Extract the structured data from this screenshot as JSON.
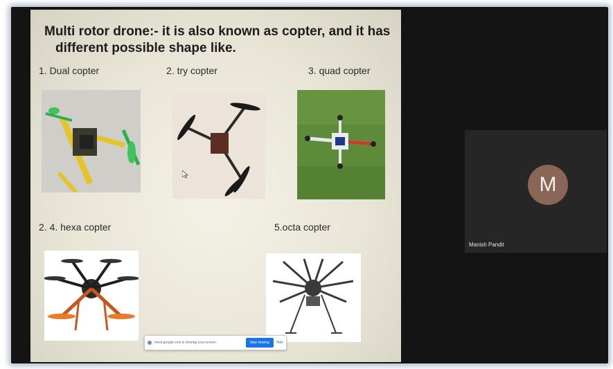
{
  "slide": {
    "title_line1": "Multi rotor  drone:- it is also known as copter, and it has",
    "title_line2": "different  possible shape like.",
    "items": [
      {
        "label": "1.   Dual copter"
      },
      {
        "label": "2.  try copter"
      },
      {
        "label": "3.  quad copter"
      },
      {
        "label": "2.   4. hexa copter"
      },
      {
        "label": "5.octa copter"
      }
    ]
  },
  "share_bar": {
    "message": "meet.google.com is sharing your screen.",
    "stop_label": "Stop sharing",
    "hide_label": "Hide"
  },
  "participant": {
    "initial": "M",
    "name": "Manish Pandit",
    "avatar_color": "#8a6656"
  },
  "colors": {
    "stop_button": "#1a73e8",
    "meeting_background": "#141414"
  }
}
